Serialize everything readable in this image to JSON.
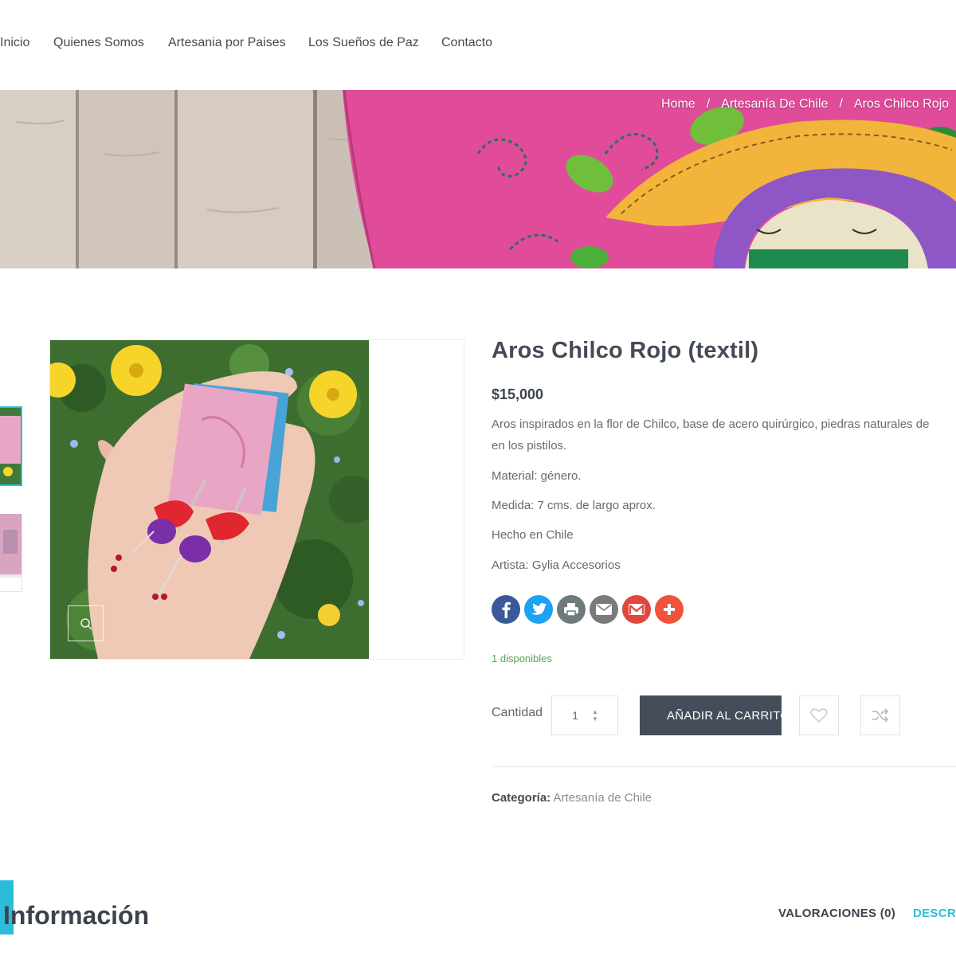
{
  "nav": {
    "items": [
      "Inicio",
      "Quienes Somos",
      "Artesania por Paises",
      "Los Sueños de Paz",
      "Contacto"
    ]
  },
  "breadcrumb": {
    "home": "Home",
    "category": "Artesanía De Chile",
    "current": "Aros Chilco Rojo"
  },
  "product": {
    "title": "Aros Chilco Rojo (textil)",
    "price": "$15,000",
    "description": [
      "Aros inspirados en la flor de Chilco, base de acero quirúrgico, piedras naturales de",
      "en los pistilos.",
      "Material: género.",
      "Medida: 7 cms. de largo aprox.",
      "Hecho en Chile",
      "Artista: Gylia Accesorios"
    ],
    "stock": "1 disponibles",
    "quantity_label": "Cantidad",
    "quantity_value": "1",
    "add_to_cart": "AÑADIR AL CARRITO",
    "category_label": "Categoría:",
    "category_value": "Artesanía de Chile"
  },
  "share": [
    {
      "icon": "facebook-icon",
      "color": "#3b5998"
    },
    {
      "icon": "twitter-icon",
      "color": "#1da1f2"
    },
    {
      "icon": "print-icon",
      "color": "#6f7a7d"
    },
    {
      "icon": "email-icon",
      "color": "#7a7a7a"
    },
    {
      "icon": "gmail-icon",
      "color": "#e0473d"
    },
    {
      "icon": "more-share-icon",
      "color": "#f0523a"
    }
  ],
  "info": {
    "heading": "Información",
    "tabs": [
      "VALORACIONES (0)",
      "DESCRIPCIÓN"
    ]
  },
  "colors": {
    "accent": "#2bbcd8",
    "button": "#464d5a",
    "stock": "#5aa25a"
  }
}
